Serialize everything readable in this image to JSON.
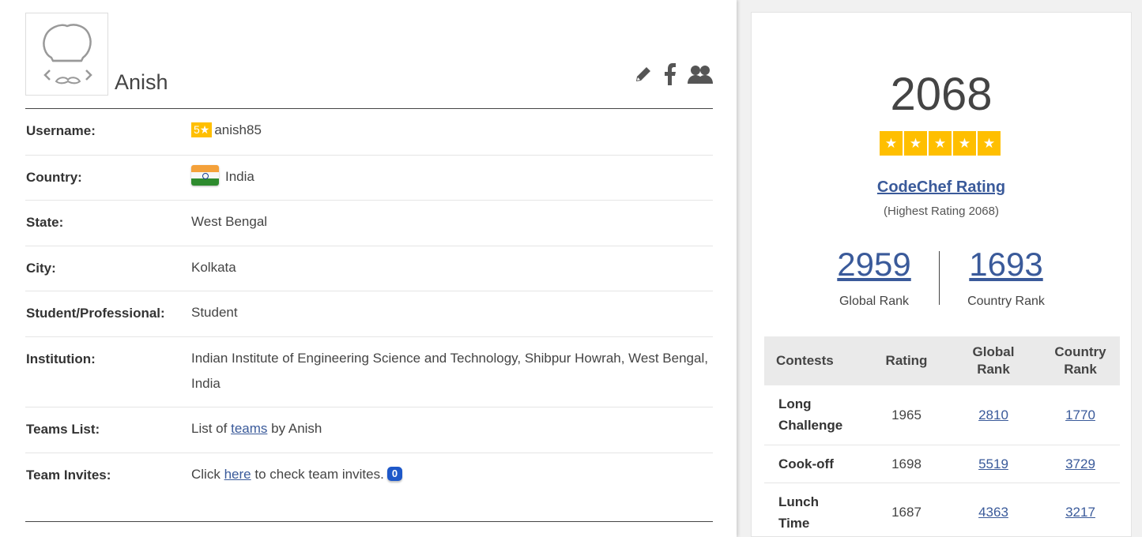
{
  "profile": {
    "name": "Anish",
    "fields": {
      "username_label": "Username:",
      "username_stars": "5★",
      "username": "anish85",
      "country_label": "Country:",
      "country": "India",
      "state_label": "State:",
      "state": "West Bengal",
      "city_label": "City:",
      "city": "Kolkata",
      "occupation_label": "Student/Professional:",
      "occupation": "Student",
      "institution_label": "Institution:",
      "institution": "Indian Institute of Engineering Science and Technology, Shibpur Howrah, West Bengal, India",
      "teams_label": "Teams List:",
      "teams_prefix": "List of",
      "teams_link": "teams",
      "teams_suffix": "by Anish",
      "invites_label": "Team Invites:",
      "invites_prefix": "Click",
      "invites_link": "here",
      "invites_suffix": "to check team invites.",
      "invites_count": "0"
    },
    "icons": [
      "pencil-icon",
      "facebook-icon",
      "users-icon"
    ]
  },
  "rating": {
    "value": "2068",
    "stars": [
      "★",
      "★",
      "★",
      "★",
      "★"
    ],
    "title": "CodeChef Rating",
    "highest": "(Highest Rating 2068)",
    "global_rank": "2959",
    "global_rank_label": "Global Rank",
    "country_rank": "1693",
    "country_rank_label": "Country Rank"
  },
  "contests_table": {
    "headers": {
      "contests": "Contests",
      "rating": "Rating",
      "global_rank_1": "Global",
      "global_rank_2": "Rank",
      "country_rank_1": "Country",
      "country_rank_2": "Rank"
    },
    "rows": [
      {
        "name_1": "Long",
        "name_2": "Challenge",
        "rating": "1965",
        "global": "2810",
        "country": "1770"
      },
      {
        "name_1": "Cook-off",
        "name_2": "",
        "rating": "1698",
        "global": "5519",
        "country": "3729"
      },
      {
        "name_1": "Lunch",
        "name_2": "Time",
        "rating": "1687",
        "global": "4363",
        "country": "3217"
      }
    ]
  },
  "colors": {
    "star": "#ffbf00",
    "link": "#3a5a9a",
    "badge": "#1e58c9"
  }
}
